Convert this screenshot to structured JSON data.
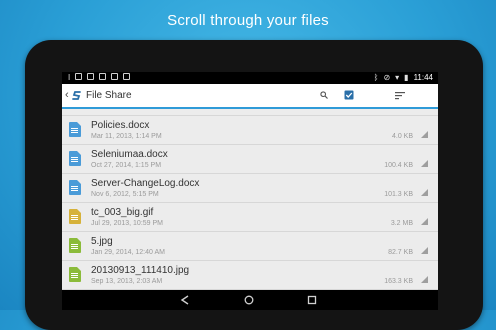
{
  "promo": {
    "caption": "Scroll through your files"
  },
  "status_bar": {
    "time": "11:44"
  },
  "app_bar": {
    "title": "File Share",
    "back_glyph": "‹"
  },
  "colors": {
    "accent": "#2f9bd8",
    "doc_icon": "#4a9bd8",
    "gif_icon": "#d6b23a",
    "jpg_icon": "#8bbb3a"
  },
  "files": [
    {
      "name": "Policies.docx",
      "date": "Mar 11, 2013, 1:14 PM",
      "size": "4.0 KB",
      "icon": "doc-icon",
      "color": "#4a9bd8"
    },
    {
      "name": "Seleniumaa.docx",
      "date": "Oct 27, 2014, 1:15 PM",
      "size": "100.4 KB",
      "icon": "doc-icon",
      "color": "#4a9bd8"
    },
    {
      "name": "Server-ChangeLog.docx",
      "date": "Nov 6, 2012, 5:15 PM",
      "size": "101.3 KB",
      "icon": "doc-icon",
      "color": "#4a9bd8"
    },
    {
      "name": "tc_003_big.gif",
      "date": "Jul 29, 2013, 10:59 PM",
      "size": "3.2 MB",
      "icon": "gif-icon",
      "color": "#d6b23a"
    },
    {
      "name": "5.jpg",
      "date": "Jan 29, 2014, 12:40 AM",
      "size": "82.7 KB",
      "icon": "image-icon",
      "color": "#8bbb3a"
    },
    {
      "name": "20130913_111410.jpg",
      "date": "Sep 13, 2013, 2:03 AM",
      "size": "163.3 KB",
      "icon": "image-icon",
      "color": "#8bbb3a"
    }
  ]
}
